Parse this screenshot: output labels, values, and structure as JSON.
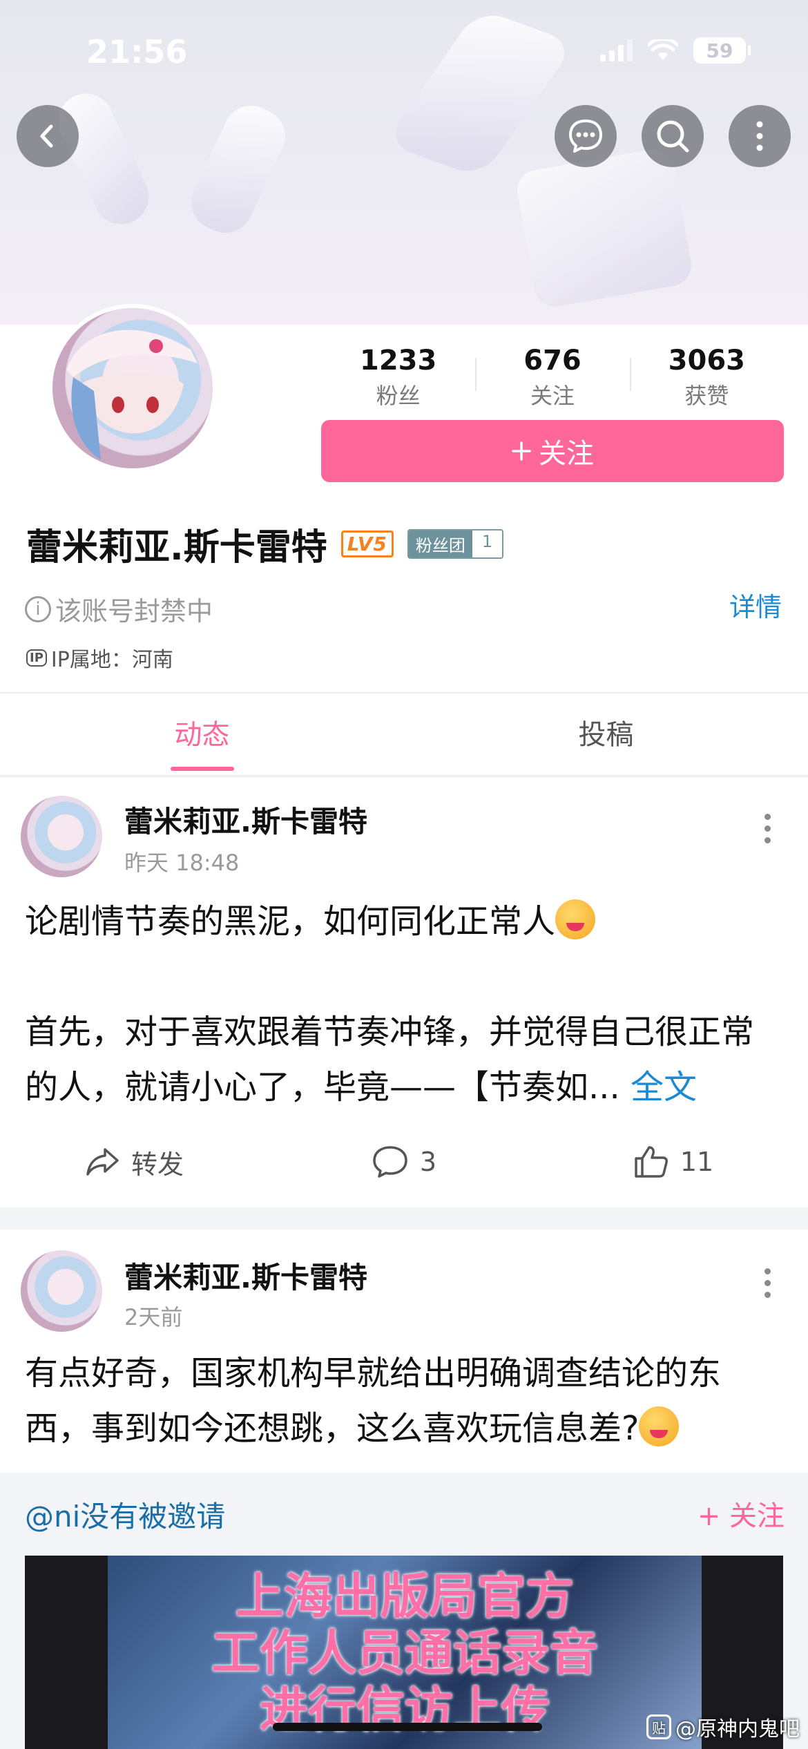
{
  "status_bar": {
    "time": "21:56",
    "battery": "59"
  },
  "profile": {
    "stats": [
      {
        "value": "1233",
        "label": "粉丝"
      },
      {
        "value": "676",
        "label": "关注"
      },
      {
        "value": "3063",
        "label": "获赞"
      }
    ],
    "follow_label": "关注",
    "name": "蕾米莉亚.斯卡雷特",
    "level_badge": "LV5",
    "fan_badge": {
      "label": "粉丝团",
      "level": "1"
    },
    "banned_notice": "该账号封禁中",
    "details_label": "详情",
    "ip_label": "IP属地：河南",
    "ip_icon": "IP"
  },
  "tabs": [
    {
      "label": "动态",
      "active": true
    },
    {
      "label": "投稿",
      "active": false
    }
  ],
  "posts": [
    {
      "author": "蕾米莉亚.斯卡雷特",
      "time": "昨天 18:48",
      "line1": "论剧情节奏的黑泥，如何同化正常人",
      "body": "首先，对于喜欢跟着节奏冲锋，并觉得自己很正常的人，就请小心了，毕竟——【节奏如...",
      "read_more": "全文",
      "repost_label": "转发",
      "comment_count": "3",
      "like_count": "11"
    },
    {
      "author": "蕾米莉亚.斯卡雷特",
      "time": "2天前",
      "body": "有点好奇，国家机构早就给出明确调查结论的东西，事到如今还想跳，这么喜欢玩信息差?"
    }
  ],
  "repost": {
    "user": "@ni没有被邀请",
    "follow_label": "+ 关注",
    "video_line1": "上海出版局官方",
    "video_line2": "工作人员通话录音",
    "video_line3": "进行信访上传"
  },
  "watermark": {
    "icon": "贴",
    "text": "@原神内鬼吧"
  },
  "colors": {
    "accent": "#ff6699",
    "link": "#1a8ad6",
    "level": "#f5821f"
  }
}
